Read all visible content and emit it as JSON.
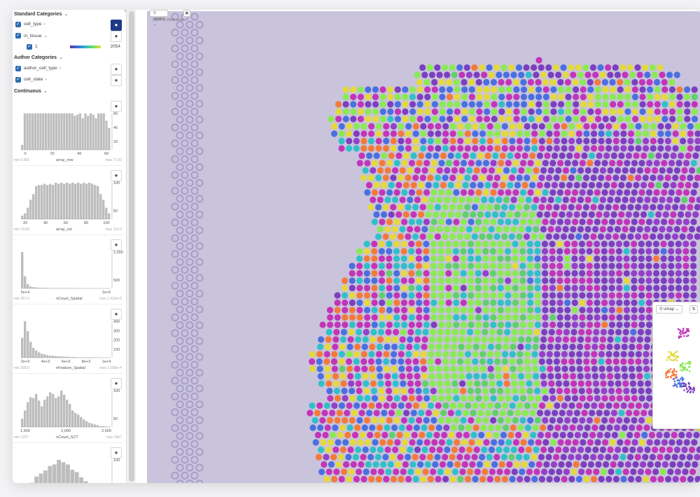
{
  "sidebar": {
    "standard_title": "Standard Categories",
    "author_title": "Author Categories",
    "continuous_title": "Continuous",
    "standard_items": [
      {
        "label": "cell_type",
        "arrow": "›"
      },
      {
        "label": "in_tissue",
        "arrow": "⌄"
      }
    ],
    "sub_item": {
      "label": "1",
      "count": "2054"
    },
    "author_items": [
      {
        "label": "author_cell_type",
        "arrow": "›"
      },
      {
        "label": "cell_state",
        "arrow": "›"
      }
    ],
    "histograms": [
      {
        "name": "array_row",
        "min": "min 0.000",
        "max": "max 77.00",
        "ticks_x": [
          "0",
          "20",
          "40",
          "60"
        ],
        "ticks_y": [
          "60",
          "40",
          "20"
        ],
        "bins": [
          4,
          30,
          30,
          30,
          30,
          30,
          30,
          30,
          30,
          30,
          30,
          30,
          30,
          30,
          30,
          30,
          30,
          30,
          30,
          30,
          28,
          29,
          30,
          26,
          30,
          28,
          30,
          29,
          26,
          30,
          30,
          30,
          24,
          18
        ]
      },
      {
        "name": "array_col",
        "min": "min 14.00",
        "max": "max 114.0",
        "ticks_x": [
          "20",
          "40",
          "60",
          "80",
          "100"
        ],
        "ticks_y": [
          "100",
          "50"
        ],
        "bins": [
          6,
          10,
          20,
          34,
          44,
          58,
          60,
          60,
          62,
          60,
          62,
          60,
          64,
          62,
          64,
          62,
          64,
          62,
          64,
          62,
          64,
          62,
          64,
          62,
          64,
          62,
          60,
          58,
          44,
          34,
          20,
          10
        ]
      },
      {
        "name": "nCount_Spatial",
        "min": "min 257.0",
        "max": "max 1.410e+5",
        "ticks_x": [
          "5e+4",
          "1e+5"
        ],
        "ticks_y": [
          "1,000",
          "500"
        ],
        "bins": [
          120,
          40,
          14,
          6,
          4,
          3,
          2,
          2,
          2,
          1,
          1,
          1,
          1,
          1,
          1,
          1,
          1,
          1,
          1,
          1,
          0,
          0,
          0,
          0,
          0,
          0,
          0,
          0,
          0,
          0,
          0,
          0
        ]
      },
      {
        "name": "nFeature_Spatial",
        "min": "min 209.0",
        "max": "max 1.308e+4",
        "ticks_x": [
          "2e+3",
          "4e+3",
          "6e+3",
          "8e+3",
          "1e+4"
        ],
        "ticks_y": [
          "400",
          "300",
          "200",
          "100"
        ],
        "bins": [
          60,
          110,
          80,
          48,
          30,
          22,
          16,
          12,
          10,
          8,
          6,
          6,
          5,
          4,
          4,
          3,
          3,
          2,
          2,
          2,
          1,
          1,
          1,
          1,
          1,
          1,
          1,
          0,
          0,
          0,
          0,
          0
        ]
      },
      {
        "name": "nCount_SCT",
        "min": "min 1207",
        "max": "max 2967",
        "ticks_x": [
          "1,500",
          "2,000",
          "2,500"
        ],
        "ticks_y": [
          "100",
          "50"
        ],
        "bins": [
          20,
          40,
          60,
          72,
          70,
          80,
          64,
          50,
          66,
          74,
          84,
          80,
          70,
          74,
          88,
          78,
          66,
          56,
          40,
          34,
          30,
          24,
          18,
          14,
          10,
          8,
          6,
          4,
          2,
          2,
          1,
          1
        ]
      },
      {
        "name": "",
        "min": "",
        "max": "",
        "ticks_x": [],
        "ticks_y": [
          "100"
        ],
        "bins": [
          10,
          20,
          36,
          52,
          60,
          68,
          80,
          84,
          96,
          90,
          84,
          70,
          64,
          50,
          40,
          30,
          20,
          10,
          6,
          4
        ]
      }
    ]
  },
  "toolbar": {
    "embedding": "spatial",
    "count_label": "2054 of 2054 cells"
  },
  "minimap": {
    "embedding": "umap",
    "sort_icon": "⇅"
  },
  "colors": {
    "tissue": "#c9c3dc",
    "fiducial": "#a79fc9",
    "dots": [
      "#c235b8",
      "#7c3fbf",
      "#4a6fe0",
      "#8aea52",
      "#e4d93c",
      "#2fc0c8",
      "#f47a3a",
      "#5fd06a",
      "#9440c9"
    ]
  }
}
